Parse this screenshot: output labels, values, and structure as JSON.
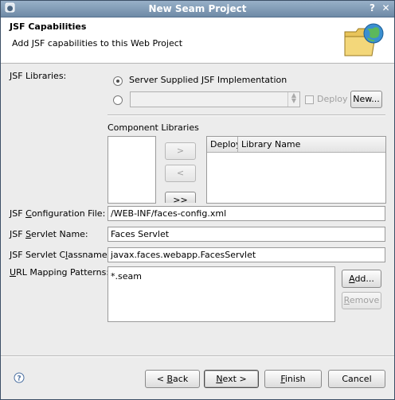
{
  "window": {
    "title": "New Seam Project",
    "help_glyph": "?",
    "close_glyph": "✕"
  },
  "header": {
    "title": "JSF Capabilities",
    "description": "Add JSF capabilities to this Web Project",
    "icon": "folder-globe-icon"
  },
  "jsf_libraries": {
    "label": "JSF Libraries:",
    "option_server": "Server Supplied JSF Implementation",
    "option_library_value": "",
    "deploy_label": "Deploy",
    "new_button": "New..."
  },
  "component_libraries": {
    "label": "Component Libraries",
    "add_button": ">",
    "remove_button": "<",
    "add_all_button": ">>",
    "columns": [
      "Deploy",
      "Library Name"
    ]
  },
  "fields": {
    "config_file": {
      "label_pre": "JSF ",
      "label_mn": "C",
      "label_post": "onfiguration File:",
      "value": "/WEB-INF/faces-config.xml"
    },
    "servlet_name": {
      "label_pre": "JSF ",
      "label_mn": "S",
      "label_post": "ervlet Name:",
      "value": "Faces Servlet"
    },
    "servlet_class": {
      "label_pre": "JSF Servlet C",
      "label_mn": "l",
      "label_post": "assname:",
      "value": "javax.faces.webapp.FacesServlet"
    },
    "url_patterns": {
      "label_pre": "",
      "label_mn": "U",
      "label_post": "RL Mapping Patterns:",
      "items": [
        "*.seam"
      ]
    }
  },
  "url_buttons": {
    "add_pre": "",
    "add_mn": "A",
    "add_post": "dd...",
    "remove_pre": "",
    "remove_mn": "R",
    "remove_post": "emove"
  },
  "footer": {
    "back_pre": "< ",
    "back_mn": "B",
    "back_post": "ack",
    "next_pre": "",
    "next_mn": "N",
    "next_post": "ext >",
    "finish_pre": "",
    "finish_mn": "F",
    "finish_post": "inish",
    "cancel": "Cancel"
  }
}
